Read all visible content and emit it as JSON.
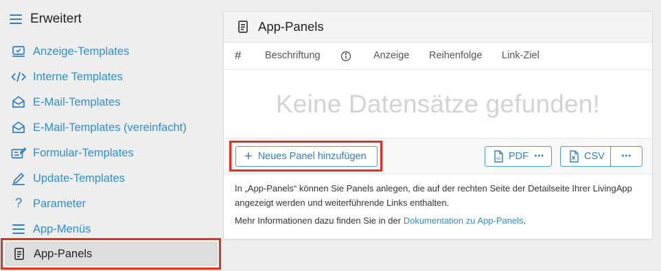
{
  "sidebar": {
    "title": "Erweitert",
    "items": [
      {
        "label": "Anzeige-Templates",
        "icon": "display-icon"
      },
      {
        "label": "Interne Templates",
        "icon": "code-icon"
      },
      {
        "label": "E-Mail-Templates",
        "icon": "envelope-open-icon"
      },
      {
        "label": "E-Mail-Templates (vereinfacht)",
        "icon": "envelope-open-icon"
      },
      {
        "label": "Formular-Templates",
        "icon": "form-edit-icon"
      },
      {
        "label": "Update-Templates",
        "icon": "pen-icon"
      },
      {
        "label": "Parameter",
        "icon": "question-icon"
      },
      {
        "label": "App-Menüs",
        "icon": "menu-lines-icon"
      },
      {
        "label": "App-Panels",
        "icon": "document-icon",
        "active": true
      }
    ]
  },
  "panel": {
    "title": "App-Panels",
    "columns": {
      "number": "#",
      "caption": "Beschriftung",
      "display": "Anzeige",
      "order": "Reihenfolge",
      "link": "Link-Ziel"
    },
    "empty_message": "Keine Datensätze gefunden!",
    "buttons": {
      "add": "Neues Panel hinzufügen",
      "pdf": "PDF",
      "csv": "CSV"
    },
    "info": {
      "line1": "In „App-Panels“ können Sie Panels anlegen, die auf der rechten Seite der Detailseite Ihrer LivingApp angezeigt werden und weiterführende Links enthalten.",
      "line2_prefix": "Mehr Informationen dazu finden Sie in der ",
      "line2_link": "Dokumentation zu App-Panels",
      "line2_suffix": "."
    }
  },
  "colors": {
    "accent": "#2f7fc1",
    "link": "#2f8fc9",
    "highlight": "#e0301e",
    "empty_text": "#d3d3d3"
  }
}
